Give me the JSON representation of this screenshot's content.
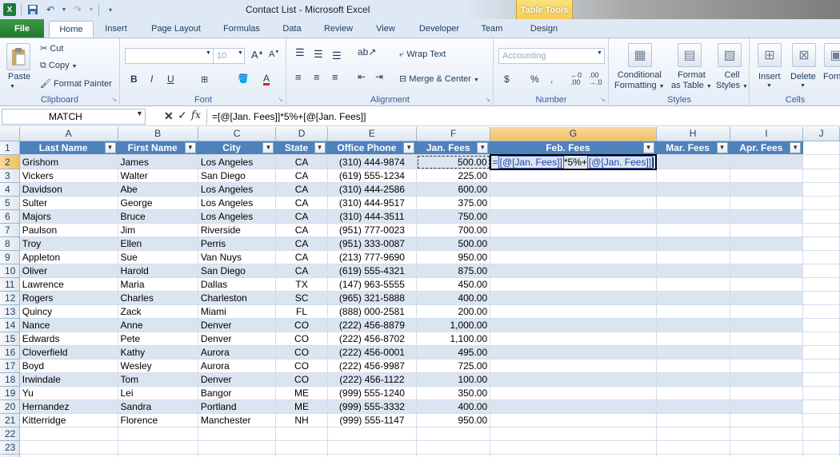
{
  "window": {
    "title": "Contact List - Microsoft Excel",
    "context_tab_group": "Table Tools"
  },
  "ribbon_tabs": [
    "File",
    "Home",
    "Insert",
    "Page Layout",
    "Formulas",
    "Data",
    "Review",
    "View",
    "Developer",
    "Team",
    "Design"
  ],
  "ribbon": {
    "clipboard": {
      "label": "Clipboard",
      "paste": "Paste",
      "cut": "Cut",
      "copy": "Copy",
      "format_painter": "Format Painter"
    },
    "font": {
      "label": "Font",
      "name_value": "",
      "size_value": "10"
    },
    "alignment": {
      "label": "Alignment",
      "wrap_text": "Wrap Text",
      "merge_center": "Merge & Center"
    },
    "number": {
      "label": "Number",
      "format_value": "Accounting"
    },
    "styles": {
      "label": "Styles",
      "conditional_formatting": [
        "Conditional",
        "Formatting"
      ],
      "format_as_table": [
        "Format",
        "as Table"
      ],
      "cell_styles": [
        "Cell",
        "Styles"
      ]
    },
    "cells": {
      "label": "Cells",
      "insert": "Insert",
      "delete": "Delete",
      "format": "Form"
    }
  },
  "formula_bar": {
    "name_box": "MATCH",
    "formula": "=[@[Jan. Fees]]*5%+[@[Jan. Fees]]"
  },
  "sheet": {
    "columns": [
      "A",
      "B",
      "C",
      "D",
      "E",
      "F",
      "G",
      "H",
      "I",
      "J"
    ],
    "selected_column": "G",
    "selected_row": 2,
    "table_headers": [
      "Last Name",
      "First Name",
      "City",
      "State",
      "Office Phone",
      "Jan. Fees",
      "Feb. Fees",
      "Mar. Fees",
      "Apr. Fees"
    ],
    "editing_cell": {
      "ref1": "[@[Jan. Fees]]",
      "mid": "*5%+",
      "ref2": "[@[Jan. Fees]]"
    },
    "rows": [
      [
        "Grishom",
        "James",
        "Los Angeles",
        "CA",
        "(310) 444-9874",
        "500.00"
      ],
      [
        "Vickers",
        "Walter",
        "San Diego",
        "CA",
        "(619) 555-1234",
        "225.00"
      ],
      [
        "Davidson",
        "Abe",
        "Los Angeles",
        "CA",
        "(310) 444-2586",
        "600.00"
      ],
      [
        "Sulter",
        "George",
        "Los Angeles",
        "CA",
        "(310) 444-9517",
        "375.00"
      ],
      [
        "Majors",
        "Bruce",
        "Los Angeles",
        "CA",
        "(310) 444-3511",
        "750.00"
      ],
      [
        "Paulson",
        "Jim",
        "Riverside",
        "CA",
        "(951) 777-0023",
        "700.00"
      ],
      [
        "Troy",
        "Ellen",
        "Perris",
        "CA",
        "(951) 333-0087",
        "500.00"
      ],
      [
        "Appleton",
        "Sue",
        "Van Nuys",
        "CA",
        "(213) 777-9690",
        "950.00"
      ],
      [
        "Oliver",
        "Harold",
        "San Diego",
        "CA",
        "(619) 555-4321",
        "875.00"
      ],
      [
        "Lawrence",
        "Maria",
        "Dallas",
        "TX",
        "(147) 963-5555",
        "450.00"
      ],
      [
        "Rogers",
        "Charles",
        "Charleston",
        "SC",
        "(965) 321-5888",
        "400.00"
      ],
      [
        "Quincy",
        "Zack",
        "Miami",
        "FL",
        "(888) 000-2581",
        "200.00"
      ],
      [
        "Nance",
        "Anne",
        "Denver",
        "CO",
        "(222) 456-8879",
        "1,000.00"
      ],
      [
        "Edwards",
        "Pete",
        "Denver",
        "CO",
        "(222) 456-8702",
        "1,100.00"
      ],
      [
        "Cloverfield",
        "Kathy",
        "Aurora",
        "CO",
        "(222) 456-0001",
        "495.00"
      ],
      [
        "Boyd",
        "Wesley",
        "Aurora",
        "CO",
        "(222) 456-9987",
        "725.00"
      ],
      [
        "Irwindale",
        "Tom",
        "Denver",
        "CO",
        "(222) 456-1122",
        "100.00"
      ],
      [
        "Yu",
        "Lei",
        "Bangor",
        "ME",
        "(999) 555-1240",
        "350.00"
      ],
      [
        "Hernandez",
        "Sandra",
        "Portland",
        "ME",
        "(999) 555-3332",
        "400.00"
      ],
      [
        "Kitterridge",
        "Florence",
        "Manchester",
        "NH",
        "(999) 555-1147",
        "950.00"
      ]
    ],
    "row_count": 24
  }
}
